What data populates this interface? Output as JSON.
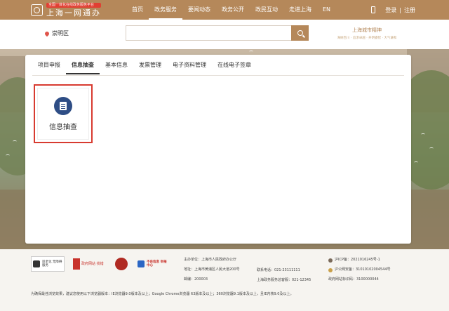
{
  "header": {
    "logo_sub": "全国一体化在线政务服务平台",
    "logo_main": "上海一网通办",
    "nav": [
      "首页",
      "政务服务",
      "要闻动态",
      "政务公开",
      "政民互动",
      "走进上海",
      "EN"
    ],
    "active_nav": "政务服务",
    "login": "登录",
    "separator": "|",
    "register": "注册",
    "brand_color": "#b5885a"
  },
  "search": {
    "location": "崇明区",
    "placeholder": "",
    "slogan_title": "上海城市精神",
    "slogan_sub": "海纳百川 · 追求卓越 · 开明睿智 · 大气谦和"
  },
  "tabs": [
    "项目申报",
    "信息抽查",
    "基本信息",
    "发票管理",
    "电子资料管理",
    "在线电子签章"
  ],
  "active_tab": "信息抽查",
  "card": {
    "label": "信息抽查",
    "icon": "document-list-icon",
    "highlight_color": "#d83b30"
  },
  "footer": {
    "badges": [
      {
        "name": "accessibility",
        "text": "适老化 无障碍服务"
      },
      {
        "name": "find-error",
        "text": "政府网站 找错"
      },
      {
        "name": "party-emblem",
        "text": ""
      },
      {
        "name": "report-center",
        "text": "不良信息 举报中心"
      }
    ],
    "organizer": "主办单位：上海市人民政府办公厅",
    "address": "地址：上海市黄浦区人民大道200号",
    "postcode": "邮编：200003",
    "phone": "联系电话：021-23111111",
    "hotline": "上海政务服务总客服：021-12345",
    "icp": "沪ICP备：2021016245号-1",
    "police": "沪公网安备：31010102004544号",
    "site_code": "政府网站标识码：3100000044",
    "notice": "为确保最佳浏览效果，建议您使用以下浏览器版本：IE浏览器9.0版本及以上；Google Chrome浏览器 63版本及以上；360浏览器9.1版本及以上，且IE内核9.0及以上。"
  }
}
